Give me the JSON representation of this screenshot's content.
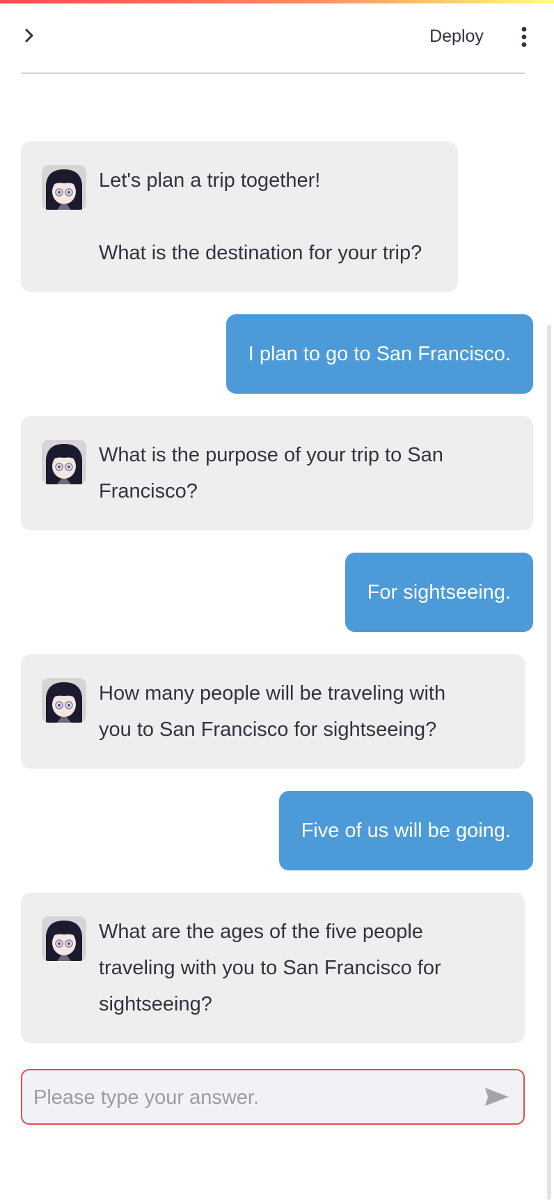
{
  "header": {
    "deploy_label": "Deploy",
    "menu_icon": "kebab-vertical-icon",
    "sidebar_icon": "chevron-right-icon"
  },
  "messages": [
    {
      "role": "assistant",
      "text": "Let's plan a trip together!\n\nWhat is the destination for your trip?"
    },
    {
      "role": "user",
      "text": "I plan to go to San Francisco."
    },
    {
      "role": "assistant",
      "text": "What is the purpose of your trip to San\nFrancisco?"
    },
    {
      "role": "user",
      "text": "For sightseeing."
    },
    {
      "role": "assistant",
      "text": "How many people will be traveling with\nyou to San Francisco for sightseeing?"
    },
    {
      "role": "user",
      "text": "Five of us will be going."
    },
    {
      "role": "assistant",
      "text": "What are the ages of the five people\ntraveling with you to San Francisco for\nsightseeing?"
    }
  ],
  "input": {
    "placeholder": "Please type your answer.",
    "value": "",
    "send_icon": "send-arrow-icon"
  },
  "colors": {
    "accent_gradient_start": "#ff4b4b",
    "accent_gradient_end": "#fffd80",
    "user_bubble": "#4c9bd8",
    "assistant_bubble": "#eeeeef",
    "input_border_focus": "#e84c4f"
  }
}
